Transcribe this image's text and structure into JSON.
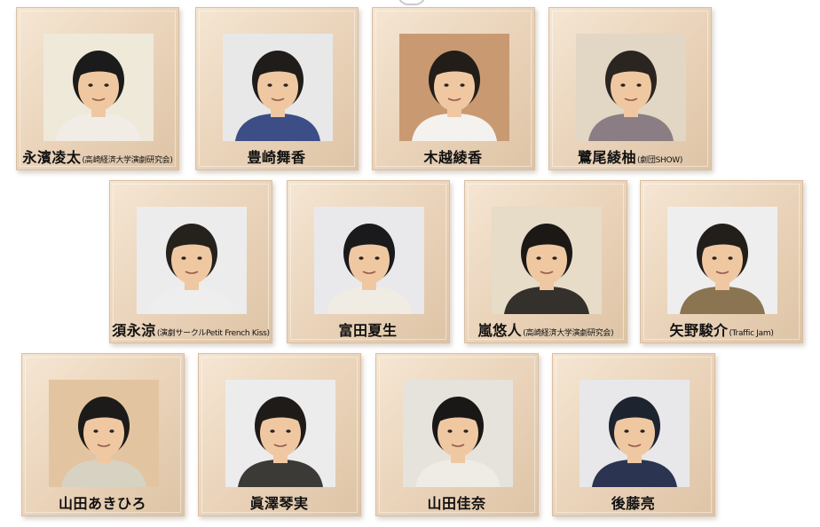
{
  "cast": [
    {
      "name": "永濱凌太",
      "affiliation": "(高崎経済大学演劇研究会)",
      "shirt": "#f1ede6",
      "hair": "#1b1b1b",
      "bg": "#efe9da"
    },
    {
      "name": "豊崎舞香",
      "affiliation": "",
      "shirt": "#3d4e86",
      "hair": "#1f1c1a",
      "bg": "#e8e8e8"
    },
    {
      "name": "木越綾香",
      "affiliation": "",
      "shirt": "#f4f2ee",
      "hair": "#221d19",
      "bg": "#c99a72"
    },
    {
      "name": "鷺尾綾柚",
      "affiliation": "(劇団SHOW)",
      "shirt": "#8a7e84",
      "hair": "#2a2520",
      "bg": "#e2d6c4"
    },
    {
      "name": "須永涼",
      "affiliation": "(演劇サークルPetit French Kiss)",
      "shirt": "#eeeeee",
      "hair": "#25211d",
      "bg": "#ececec"
    },
    {
      "name": "富田夏生",
      "affiliation": "",
      "shirt": "#f0ece4",
      "hair": "#1a1a1d",
      "bg": "#e9e9ec"
    },
    {
      "name": "嵐悠人",
      "affiliation": "(高崎経済大学演劇研究会)",
      "shirt": "#34302c",
      "hair": "#1b1816",
      "bg": "#e6dcc8"
    },
    {
      "name": "矢野駿介",
      "affiliation": "(Traffic Jam)",
      "shirt": "#8a7452",
      "hair": "#221e1a",
      "bg": "#eeeeee"
    },
    {
      "name": "山田あきひろ",
      "affiliation": "",
      "shirt": "#d8d2c2",
      "hair": "#1d1b1a",
      "bg": "#e2c5a0"
    },
    {
      "name": "眞澤琴実",
      "affiliation": "",
      "shirt": "#3c3a36",
      "hair": "#1f1b18",
      "bg": "#ececec"
    },
    {
      "name": "山田佳奈",
      "affiliation": "",
      "shirt": "#efece6",
      "hair": "#1a1817",
      "bg": "#e6e2dc"
    },
    {
      "name": "後藤亮",
      "affiliation": "",
      "shirt": "#2b3552",
      "hair": "#1d2430",
      "bg": "#e8e8ea"
    }
  ],
  "colors": {
    "frame_wood": "#ebd6bd",
    "skin": "#efc8a2",
    "caption_text": "#111111"
  }
}
